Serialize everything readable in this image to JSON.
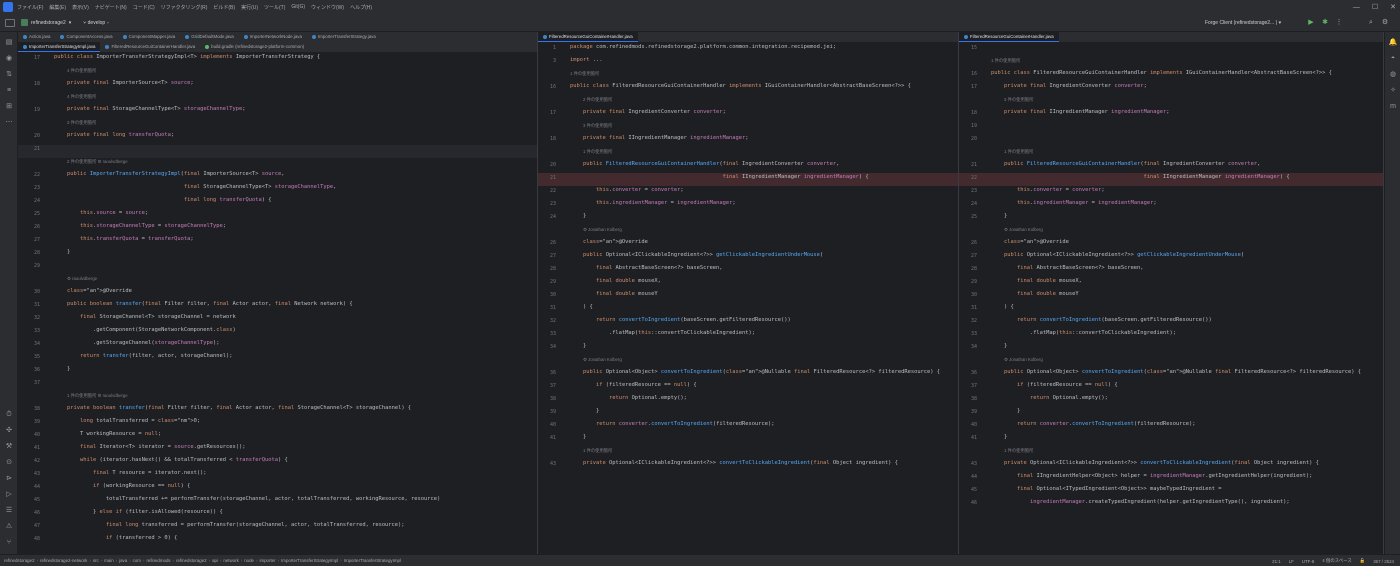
{
  "titlebar": {
    "menus": [
      "ファイル(F)",
      "編集(E)",
      "表示(V)",
      "ナビゲート(N)",
      "コード(C)",
      "リファクタリング(R)",
      "ビルド(B)",
      "実行(U)",
      "ツール(T)",
      "Git(G)",
      "ウィンドウ(W)",
      "ヘルプ(H)"
    ],
    "minimize": "—",
    "maximize": "☐",
    "close": "✕"
  },
  "toolbar": {
    "project": "refinedstorage2",
    "branch": "develop",
    "run_config": "Forge Client (refinedstorage2... ) ▾",
    "run": "▶",
    "debug": "✱",
    "more": "⋮"
  },
  "panes": [
    {
      "tabs_row1": [
        "Action.java",
        "ComponentAccess.java",
        "ComponentMapper.java",
        "GridDefaultMode.java",
        "ImporterNetworkNode.java",
        "ImporterTransferStrategy.java"
      ],
      "tabs_row2": [
        "ImporterTransferStrategyImpl.java",
        "FilteredResourceGuiContainerHandler.java",
        "build.gradle (refinedstorage2-platform-common)"
      ]
    },
    {
      "tabs_row1": [
        "FilteredResourceGuiContainerHandler.java"
      ]
    },
    {
      "tabs_row1": [
        "FilteredResourceGuiContainerHandler.java"
      ]
    }
  ],
  "left_code": {
    "hints": {
      "h18": "4 件の使用箇所",
      "h19": "4 件の使用箇所",
      "h20": "3 件の使用箇所",
      "h22": "2 件の使用箇所   ⚙ raoulvdberge",
      "h28": "⚙ raoulvdberge",
      "h35": "1 件の使用箇所   ⚙ raoulvdberge"
    },
    "lines": [
      {
        "n": "17",
        "t": "public class ImporterTransferStrategyImpl<T> implements ImporterTransferStrategy {"
      },
      {
        "n": "18",
        "t": "    private final ImporterSource<T> source;"
      },
      {
        "n": "19",
        "t": "    private final StorageChannelType<T> storageChannelType;"
      },
      {
        "n": "20",
        "t": "    private final long transferQuota;"
      },
      {
        "n": "21",
        "t": ""
      },
      {
        "n": "22",
        "t": "    public ImporterTransferStrategyImpl(final ImporterSource<T> source,"
      },
      {
        "n": "23",
        "t": "                                        final StorageChannelType<T> storageChannelType,"
      },
      {
        "n": "24",
        "t": "                                        final long transferQuota) {"
      },
      {
        "n": "25",
        "t": "        this.source = source;"
      },
      {
        "n": "26",
        "t": "        this.storageChannelType = storageChannelType;"
      },
      {
        "n": "27",
        "t": "        this.transferQuota = transferQuota;"
      },
      {
        "n": "28",
        "t": "    }"
      },
      {
        "n": "29",
        "t": ""
      },
      {
        "n": "30",
        "t": "    @Override"
      },
      {
        "n": "31",
        "t": "    public boolean transfer(final Filter filter, final Actor actor, final Network network) {"
      },
      {
        "n": "32",
        "t": "        final StorageChannel<T> storageChannel = network"
      },
      {
        "n": "33",
        "t": "            .getComponent(StorageNetworkComponent.class)"
      },
      {
        "n": "34",
        "t": "            .getStorageChannel(storageChannelType);"
      },
      {
        "n": "35",
        "t": "        return transfer(filter, actor, storageChannel);"
      },
      {
        "n": "36",
        "t": "    }"
      },
      {
        "n": "37",
        "t": ""
      },
      {
        "n": "38",
        "t": "    private boolean transfer(final Filter filter, final Actor actor, final StorageChannel<T> storageChannel) {"
      },
      {
        "n": "39",
        "t": "        long totalTransferred = 0;"
      },
      {
        "n": "40",
        "t": "        T workingResource = null;"
      },
      {
        "n": "41",
        "t": "        final Iterator<T> iterator = source.getResources();"
      },
      {
        "n": "42",
        "t": "        while (iterator.hasNext() && totalTransferred < transferQuota) {"
      },
      {
        "n": "43",
        "t": "            final T resource = iterator.next();"
      },
      {
        "n": "44",
        "t": "            if (workingResource == null) {"
      },
      {
        "n": "45",
        "t": "                totalTransferred += performTransfer(storageChannel, actor, totalTransferred, workingResource, resource)"
      },
      {
        "n": "46",
        "t": "            } else if (filter.isAllowed(resource)) {"
      },
      {
        "n": "47",
        "t": "                final long transferred = performTransfer(storageChannel, actor, totalTransferred, resource);"
      },
      {
        "n": "48",
        "t": "                if (transferred > 0) {"
      }
    ]
  },
  "mid_code": {
    "hints": {
      "author": "⚙ Jonathan Kolberg",
      "usage4": "4 件の使用箇所",
      "usage3": "3 件の使用箇所",
      "usage2": "2 件の使用箇所",
      "usage1": "1 件の使用箇所"
    },
    "lines": [
      {
        "n": "1",
        "t": "package com.refinedmods.refinedstorage2.platform.common.integration.recipemod.jei;"
      },
      {
        "n": "3",
        "t": "import ..."
      },
      {
        "n": "16",
        "t": "public class FilteredResourceGuiContainerHandler implements IGuiContainerHandler<AbstractBaseScreen<?>> {"
      },
      {
        "n": "17",
        "t": "    private final IngredientConverter converter;"
      },
      {
        "n": "18",
        "t": "    private final IIngredientManager ingredientManager;"
      },
      {
        "n": "20",
        "t": "    public FilteredResourceGuiContainerHandler(final IngredientConverter converter,"
      },
      {
        "n": "21",
        "t": "                                               final IIngredientManager ingredientManager) {"
      },
      {
        "n": "22",
        "t": "        this.converter = converter;"
      },
      {
        "n": "23",
        "t": "        this.ingredientManager = ingredientManager;"
      },
      {
        "n": "24",
        "t": "    }"
      },
      {
        "n": "26",
        "t": "    @Override"
      },
      {
        "n": "27",
        "t": "    public Optional<IClickableIngredient<?>> getClickableIngredientUnderMouse("
      },
      {
        "n": "28",
        "t": "        final AbstractBaseScreen<?> baseScreen,"
      },
      {
        "n": "29",
        "t": "        final double mouseX,"
      },
      {
        "n": "30",
        "t": "        final double mouseY"
      },
      {
        "n": "31",
        "t": "    ) {"
      },
      {
        "n": "32",
        "t": "        return convertToIngredient(baseScreen.getFilteredResource())"
      },
      {
        "n": "33",
        "t": "            .flatMap(this::convertToClickableIngredient);"
      },
      {
        "n": "34",
        "t": "    }"
      },
      {
        "n": "36",
        "t": "    public Optional<Object> convertToIngredient(@Nullable final FilteredResource<?> filteredResource) {"
      },
      {
        "n": "37",
        "t": "        if (filteredResource == null) {"
      },
      {
        "n": "38",
        "t": "            return Optional.empty();"
      },
      {
        "n": "39",
        "t": "        }"
      },
      {
        "n": "40",
        "t": "        return converter.convertToIngredient(filteredResource);"
      },
      {
        "n": "41",
        "t": "    }"
      },
      {
        "n": "43",
        "t": "    private Optional<IClickableIngredient<?>> convertToClickableIngredient(final Object ingredient) {"
      }
    ]
  },
  "right_code": {
    "lines": [
      {
        "n": "15",
        "t": ""
      },
      {
        "n": "16",
        "t": "public class FilteredResourceGuiContainerHandler implements IGuiContainerHandler<AbstractBaseScreen<?>> {"
      },
      {
        "n": "17",
        "t": "    private final IngredientConverter converter;"
      },
      {
        "n": "18",
        "t": "    private final IIngredientManager ingredientManager;"
      },
      {
        "n": "19",
        "t": ""
      },
      {
        "n": "20",
        "t": ""
      },
      {
        "n": "21",
        "t": "    public FilteredResourceGuiContainerHandler(final IngredientConverter converter,"
      },
      {
        "n": "22",
        "t": "                                               final IIngredientManager ingredientManager) {"
      },
      {
        "n": "23",
        "t": "        this.converter = converter;"
      },
      {
        "n": "24",
        "t": "        this.ingredientManager = ingredientManager;"
      },
      {
        "n": "25",
        "t": "    }"
      },
      {
        "n": "26",
        "t": "    @Override"
      },
      {
        "n": "27",
        "t": "    public Optional<IClickableIngredient<?>> getClickableIngredientUnderMouse("
      },
      {
        "n": "28",
        "t": "        final AbstractBaseScreen<?> baseScreen,"
      },
      {
        "n": "29",
        "t": "        final double mouseX,"
      },
      {
        "n": "30",
        "t": "        final double mouseY"
      },
      {
        "n": "31",
        "t": "    ) {"
      },
      {
        "n": "32",
        "t": "        return convertToIngredient(baseScreen.getFilteredResource())"
      },
      {
        "n": "33",
        "t": "            .flatMap(this::convertToClickableIngredient);"
      },
      {
        "n": "34",
        "t": "    }"
      },
      {
        "n": "36",
        "t": "    public Optional<Object> convertToIngredient(@Nullable final FilteredResource<?> filteredResource) {"
      },
      {
        "n": "37",
        "t": "        if (filteredResource == null) {"
      },
      {
        "n": "38",
        "t": "            return Optional.empty();"
      },
      {
        "n": "39",
        "t": "        }"
      },
      {
        "n": "40",
        "t": "        return converter.convertToIngredient(filteredResource);"
      },
      {
        "n": "41",
        "t": "    }"
      },
      {
        "n": "43",
        "t": "    private Optional<IClickableIngredient<?>> convertToClickableIngredient(final Object ingredient) {"
      },
      {
        "n": "44",
        "t": "        final IIngredientHelper<Object> helper = ingredientManager.getIngredientHelper(ingredient);"
      },
      {
        "n": "45",
        "t": "        final Optional<ITypedIngredient<Object>> maybeTypedIngredient ="
      },
      {
        "n": "46",
        "t": "            ingredientManager.createTypedIngredient(helper.getIngredientType(), ingredient);"
      }
    ]
  },
  "statusbar": {
    "crumbs": [
      "refinedstorage2",
      "refinedstorage2-network",
      "src",
      "main",
      "java",
      "com",
      "refinedmods",
      "refinedstorage2",
      "api",
      "network",
      "node",
      "importer",
      "ImporterTransferStrategyImpl",
      "ImporterTransferStrategyImpl"
    ],
    "position": "21:1",
    "line_sep": "LF",
    "encoding": "UTF-8",
    "indent": "4 個のスペース",
    "memory": "367 / 2524"
  },
  "colors": {
    "bg": "#1e1f22",
    "panel": "#2b2d30",
    "keyword": "#cf8e6d",
    "field": "#c77dbb",
    "method": "#56a8f5",
    "annotation": "#b3ae60",
    "accent": "#3574f0"
  }
}
